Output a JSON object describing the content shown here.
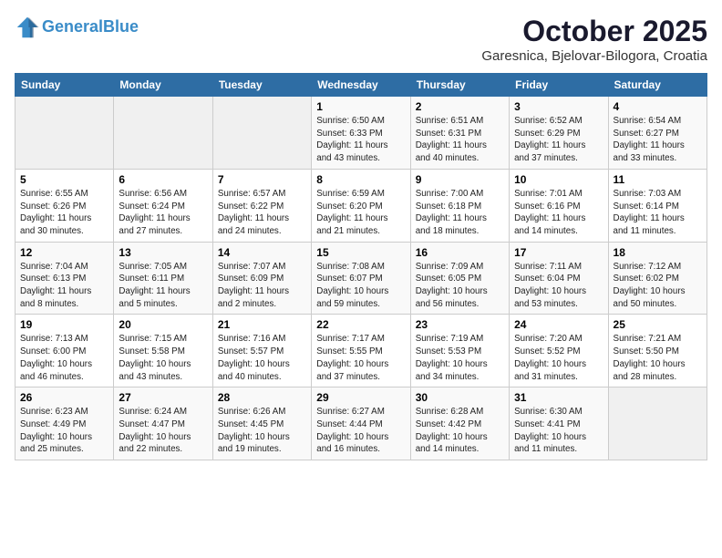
{
  "header": {
    "logo_line1": "General",
    "logo_line2": "Blue",
    "title": "October 2025",
    "subtitle": "Garesnica, Bjelovar-Bilogora, Croatia"
  },
  "weekdays": [
    "Sunday",
    "Monday",
    "Tuesday",
    "Wednesday",
    "Thursday",
    "Friday",
    "Saturday"
  ],
  "weeks": [
    [
      {
        "day": "",
        "info": ""
      },
      {
        "day": "",
        "info": ""
      },
      {
        "day": "",
        "info": ""
      },
      {
        "day": "1",
        "info": "Sunrise: 6:50 AM\nSunset: 6:33 PM\nDaylight: 11 hours\nand 43 minutes."
      },
      {
        "day": "2",
        "info": "Sunrise: 6:51 AM\nSunset: 6:31 PM\nDaylight: 11 hours\nand 40 minutes."
      },
      {
        "day": "3",
        "info": "Sunrise: 6:52 AM\nSunset: 6:29 PM\nDaylight: 11 hours\nand 37 minutes."
      },
      {
        "day": "4",
        "info": "Sunrise: 6:54 AM\nSunset: 6:27 PM\nDaylight: 11 hours\nand 33 minutes."
      }
    ],
    [
      {
        "day": "5",
        "info": "Sunrise: 6:55 AM\nSunset: 6:26 PM\nDaylight: 11 hours\nand 30 minutes."
      },
      {
        "day": "6",
        "info": "Sunrise: 6:56 AM\nSunset: 6:24 PM\nDaylight: 11 hours\nand 27 minutes."
      },
      {
        "day": "7",
        "info": "Sunrise: 6:57 AM\nSunset: 6:22 PM\nDaylight: 11 hours\nand 24 minutes."
      },
      {
        "day": "8",
        "info": "Sunrise: 6:59 AM\nSunset: 6:20 PM\nDaylight: 11 hours\nand 21 minutes."
      },
      {
        "day": "9",
        "info": "Sunrise: 7:00 AM\nSunset: 6:18 PM\nDaylight: 11 hours\nand 18 minutes."
      },
      {
        "day": "10",
        "info": "Sunrise: 7:01 AM\nSunset: 6:16 PM\nDaylight: 11 hours\nand 14 minutes."
      },
      {
        "day": "11",
        "info": "Sunrise: 7:03 AM\nSunset: 6:14 PM\nDaylight: 11 hours\nand 11 minutes."
      }
    ],
    [
      {
        "day": "12",
        "info": "Sunrise: 7:04 AM\nSunset: 6:13 PM\nDaylight: 11 hours\nand 8 minutes."
      },
      {
        "day": "13",
        "info": "Sunrise: 7:05 AM\nSunset: 6:11 PM\nDaylight: 11 hours\nand 5 minutes."
      },
      {
        "day": "14",
        "info": "Sunrise: 7:07 AM\nSunset: 6:09 PM\nDaylight: 11 hours\nand 2 minutes."
      },
      {
        "day": "15",
        "info": "Sunrise: 7:08 AM\nSunset: 6:07 PM\nDaylight: 10 hours\nand 59 minutes."
      },
      {
        "day": "16",
        "info": "Sunrise: 7:09 AM\nSunset: 6:05 PM\nDaylight: 10 hours\nand 56 minutes."
      },
      {
        "day": "17",
        "info": "Sunrise: 7:11 AM\nSunset: 6:04 PM\nDaylight: 10 hours\nand 53 minutes."
      },
      {
        "day": "18",
        "info": "Sunrise: 7:12 AM\nSunset: 6:02 PM\nDaylight: 10 hours\nand 50 minutes."
      }
    ],
    [
      {
        "day": "19",
        "info": "Sunrise: 7:13 AM\nSunset: 6:00 PM\nDaylight: 10 hours\nand 46 minutes."
      },
      {
        "day": "20",
        "info": "Sunrise: 7:15 AM\nSunset: 5:58 PM\nDaylight: 10 hours\nand 43 minutes."
      },
      {
        "day": "21",
        "info": "Sunrise: 7:16 AM\nSunset: 5:57 PM\nDaylight: 10 hours\nand 40 minutes."
      },
      {
        "day": "22",
        "info": "Sunrise: 7:17 AM\nSunset: 5:55 PM\nDaylight: 10 hours\nand 37 minutes."
      },
      {
        "day": "23",
        "info": "Sunrise: 7:19 AM\nSunset: 5:53 PM\nDaylight: 10 hours\nand 34 minutes."
      },
      {
        "day": "24",
        "info": "Sunrise: 7:20 AM\nSunset: 5:52 PM\nDaylight: 10 hours\nand 31 minutes."
      },
      {
        "day": "25",
        "info": "Sunrise: 7:21 AM\nSunset: 5:50 PM\nDaylight: 10 hours\nand 28 minutes."
      }
    ],
    [
      {
        "day": "26",
        "info": "Sunrise: 6:23 AM\nSunset: 4:49 PM\nDaylight: 10 hours\nand 25 minutes."
      },
      {
        "day": "27",
        "info": "Sunrise: 6:24 AM\nSunset: 4:47 PM\nDaylight: 10 hours\nand 22 minutes."
      },
      {
        "day": "28",
        "info": "Sunrise: 6:26 AM\nSunset: 4:45 PM\nDaylight: 10 hours\nand 19 minutes."
      },
      {
        "day": "29",
        "info": "Sunrise: 6:27 AM\nSunset: 4:44 PM\nDaylight: 10 hours\nand 16 minutes."
      },
      {
        "day": "30",
        "info": "Sunrise: 6:28 AM\nSunset: 4:42 PM\nDaylight: 10 hours\nand 14 minutes."
      },
      {
        "day": "31",
        "info": "Sunrise: 6:30 AM\nSunset: 4:41 PM\nDaylight: 10 hours\nand 11 minutes."
      },
      {
        "day": "",
        "info": ""
      }
    ]
  ]
}
